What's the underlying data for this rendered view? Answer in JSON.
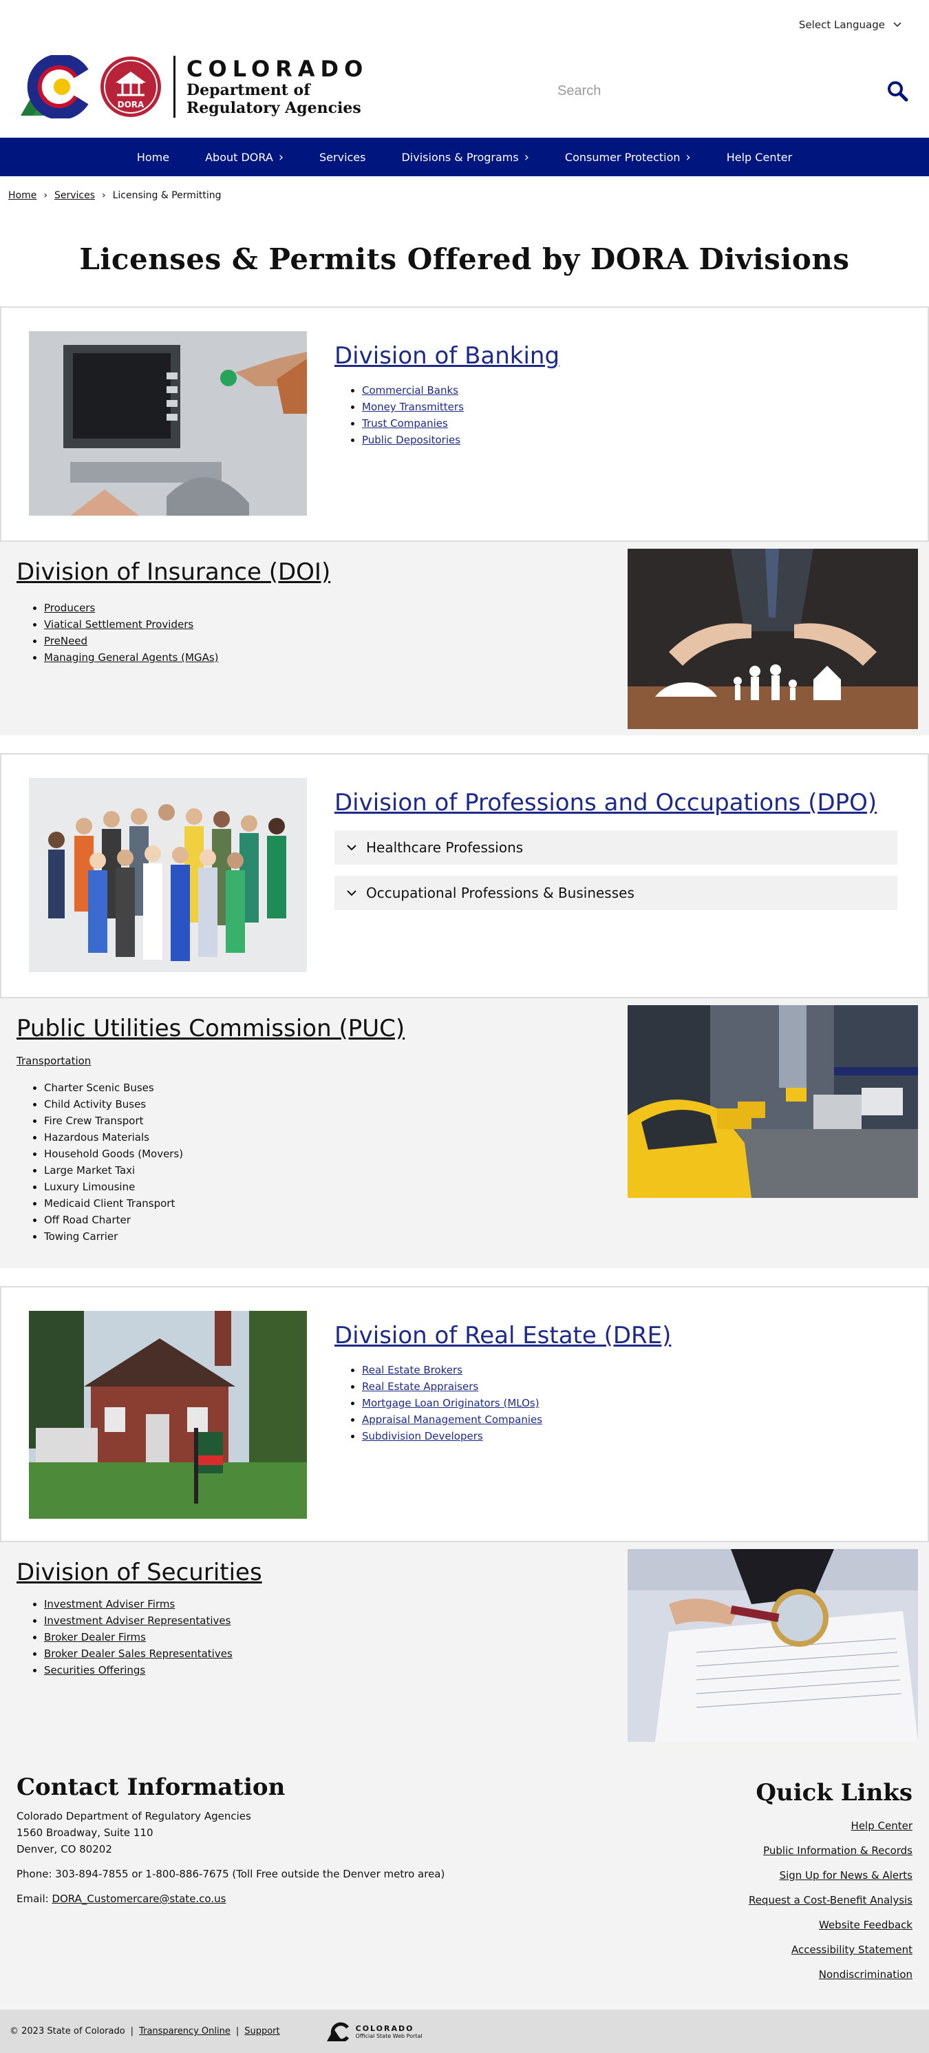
{
  "header": {
    "language": "Select Language",
    "logo_state": "COLORADO",
    "logo_dept_line1": "Department of",
    "logo_dept_line2": "Regulatory Agencies",
    "logo_badge": "DORA",
    "search_placeholder": "Search"
  },
  "nav": [
    {
      "label": "Home"
    },
    {
      "label": "About DORA"
    },
    {
      "label": "Services"
    },
    {
      "label": "Divisions & Programs"
    },
    {
      "label": "Consumer Protection"
    },
    {
      "label": "Help Center"
    }
  ],
  "breadcrumb": [
    "Home",
    "Services",
    "Licensing & Permitting"
  ],
  "page_title": "Licenses & Permits Offered by DORA Divisions",
  "banking": {
    "title": "Division of Banking",
    "items": [
      "Commercial Banks",
      "Money Transmitters",
      "Trust Companies",
      "Public Depositories"
    ]
  },
  "insurance": {
    "title": "Division of Insurance (DOI)",
    "items": [
      "Producers",
      "Viatical Settlement Providers",
      "PreNeed",
      "Managing General Agents (MGAs)"
    ]
  },
  "dpo": {
    "title": "Division of Professions and Occupations (DPO)",
    "accordions": [
      "Healthcare Professions",
      "Occupational Professions & Businesses"
    ]
  },
  "puc": {
    "title": "Public Utilities Commission (PUC)",
    "sub": "Transportation",
    "items": [
      "Charter Scenic Buses",
      "Child Activity Buses",
      "Fire Crew Transport",
      "Hazardous Materials",
      "Household Goods (Movers)",
      "Large Market Taxi",
      "Luxury Limousine",
      "Medicaid Client Transport",
      "Off Road Charter",
      "Towing Carrier"
    ]
  },
  "realestate": {
    "title": "Division of Real Estate (DRE)",
    "items": [
      "Real Estate Brokers",
      "Real Estate Appraisers",
      "Mortgage Loan Originators (MLOs)",
      "Appraisal Management Companies",
      "Subdivision Developers"
    ]
  },
  "securities": {
    "title": "Division of Securities",
    "items": [
      "Investment Adviser Firms",
      "Investment Adviser Representatives",
      "Broker Dealer Firms",
      "Broker Dealer Sales Representatives",
      "Securities Offerings"
    ]
  },
  "footer": {
    "contact_title": "Contact Information",
    "org": "Colorado Department of Regulatory Agencies",
    "address1": "1560 Broadway, Suite 110",
    "address2": "Denver, CO 80202",
    "phone": "Phone: 303-894-7855 or 1-800-886-7675 (Toll Free outside the Denver metro area)",
    "email_label": "Email: ",
    "email": "DORA_Customercare@state.co.us",
    "quick_title": "Quick Links",
    "quick_links": [
      "Help Center",
      "Public Information & Records",
      "Sign Up for News & Alerts",
      "Request a Cost-Benefit Analysis",
      "Website Feedback",
      "Accessibility Statement",
      "Nondiscrimination"
    ],
    "copyright": "© 2023 State of Colorado",
    "sep": "|",
    "transparency": "Transparency Online",
    "support": "Support",
    "portal_1": "COLORADO",
    "portal_2": "Official State Web Portal"
  }
}
